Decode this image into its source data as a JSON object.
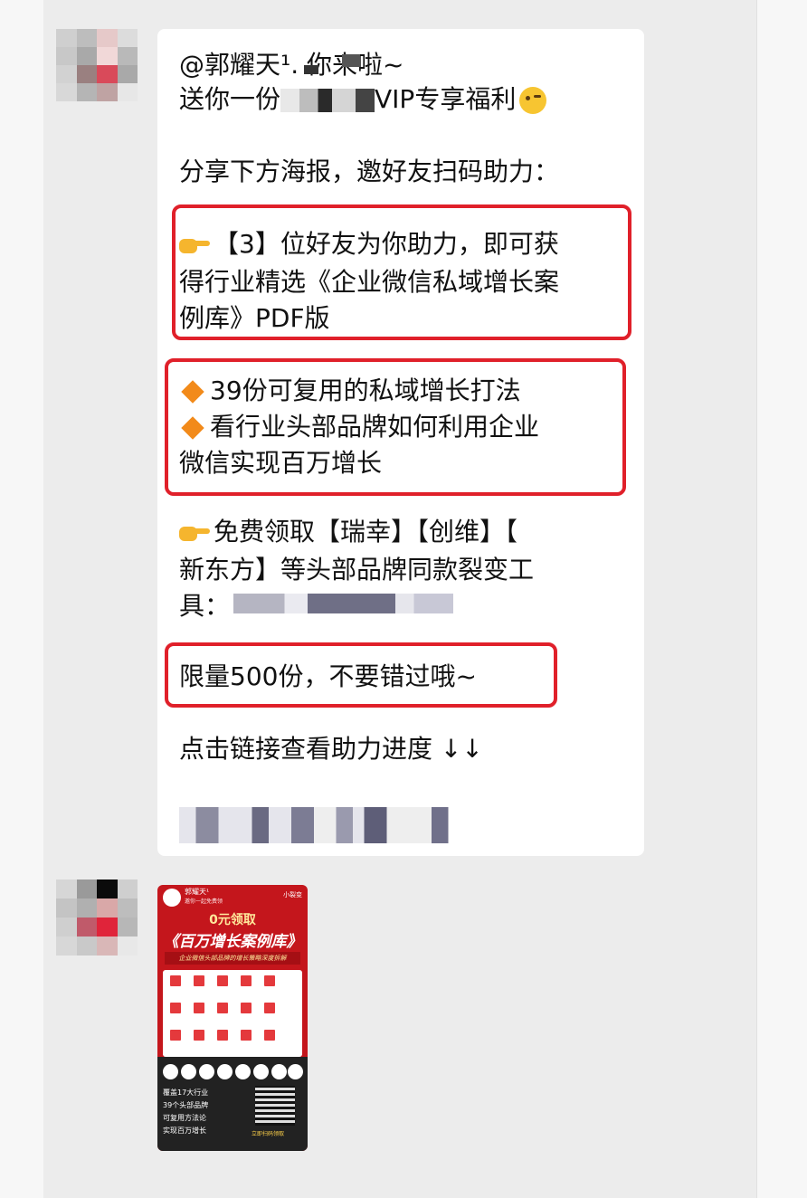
{
  "message": {
    "line1": "@郭耀天¹.  你来啦~",
    "line2_prefix": "送你一份",
    "line2_suffix": "VIP专享福利",
    "line3": "分享下方海报，邀好友扫码助力：",
    "box1": [
      "【3】位好友为你助力，即可获",
      "得行业精选《企业微信私域增长案",
      "例库》PDF版"
    ],
    "box2": [
      "39份可复用的私域增长打法",
      "看行业头部品牌如何利用企业",
      "微信实现百万增长"
    ],
    "free": [
      "免费领取【瑞幸】【创维】【",
      "新东方】等头部品牌同款裂变工",
      "具："
    ],
    "limited": "限量500份，不要错过哦~",
    "click": "点击链接查看助力进度 ↓↓"
  },
  "poster": {
    "name": "郭耀天¹",
    "subtitle": "邀你一起免费领",
    "brand": "小裂变",
    "zero": "0元领取",
    "title": "《百万增长案例库》",
    "tagline": "企业微信头部品牌的增长策略深度拆解",
    "bullets": [
      "覆盖17大行业",
      "39个头部品牌",
      "可复用方法论",
      "实现百万增长"
    ],
    "scan": "立即扫码领取"
  },
  "colors": {
    "highlight": "#e0202a",
    "poster_red": "#c4161c",
    "bubble": "#ffffff",
    "chat_bg": "#ececec"
  }
}
